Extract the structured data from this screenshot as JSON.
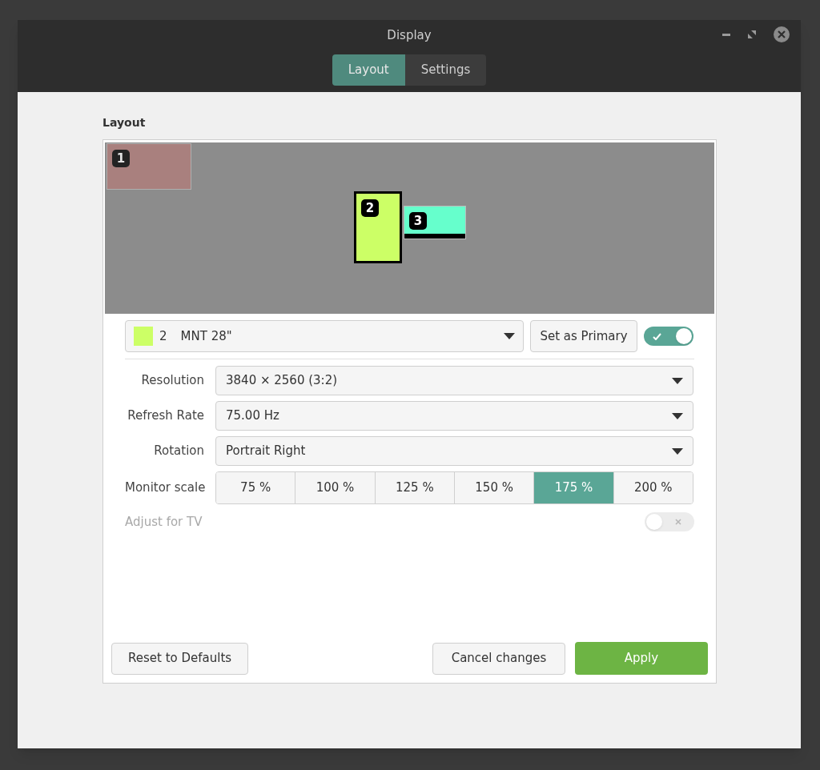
{
  "window": {
    "title": "Display"
  },
  "tabs": [
    {
      "label": "Layout",
      "selected": true
    },
    {
      "label": "Settings",
      "selected": false
    }
  ],
  "section_title": "Layout",
  "monitors": [
    {
      "label": "1",
      "color": "#b37c7a",
      "selected": false,
      "enabled": false,
      "panel": false
    },
    {
      "label": "2",
      "color": "#ccff66",
      "selected": true,
      "enabled": true,
      "panel": false
    },
    {
      "label": "3",
      "color": "#66ffcc",
      "selected": false,
      "enabled": true,
      "panel": true
    }
  ],
  "monitor_select": {
    "color": "#ccff66",
    "number": "2",
    "name": "MNT 28\""
  },
  "set_primary_button": "Set as Primary",
  "monitor_enabled": {
    "on": true
  },
  "fields": [
    {
      "label": "Resolution",
      "value": "3840 × 2560 (3:2)"
    },
    {
      "label": "Refresh Rate",
      "value": "75.00 Hz"
    },
    {
      "label": "Rotation",
      "value": "Portrait Right"
    }
  ],
  "monitor_scale": {
    "label": "Monitor scale",
    "options": [
      {
        "label": "75 %",
        "selected": false
      },
      {
        "label": "100 %",
        "selected": false
      },
      {
        "label": "125 %",
        "selected": false
      },
      {
        "label": "150 %",
        "selected": false
      },
      {
        "label": "175 %",
        "selected": true
      },
      {
        "label": "200 %",
        "selected": false
      }
    ]
  },
  "adjust_for_tv": {
    "label": "Adjust for TV",
    "on": false,
    "disabled": true
  },
  "buttons": {
    "reset": "Reset to Defaults",
    "cancel": "Cancel changes",
    "apply": "Apply"
  }
}
